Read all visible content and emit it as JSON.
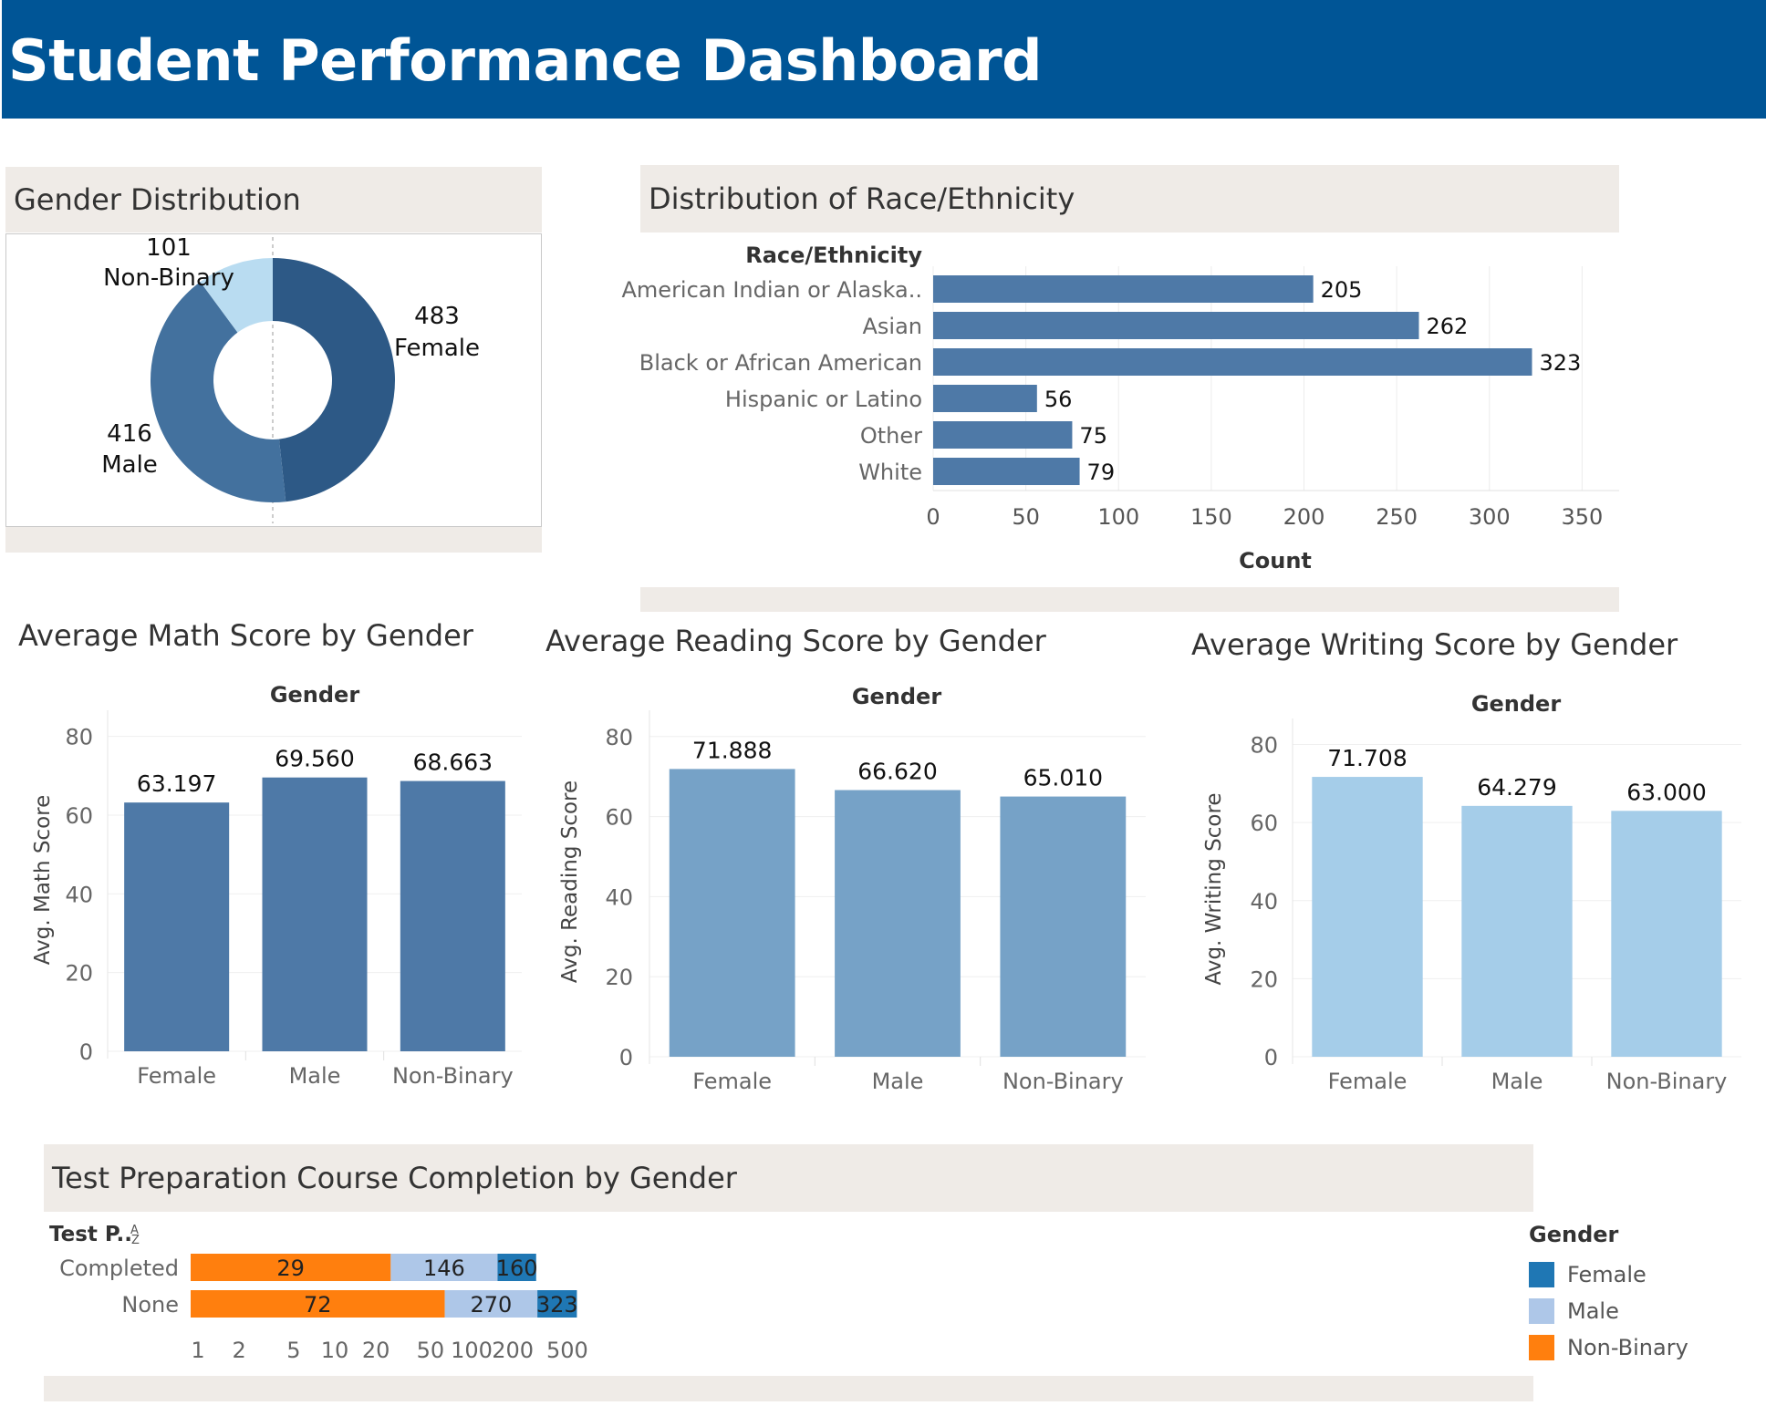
{
  "header": {
    "title": "Student Performance Dashboard"
  },
  "colors": {
    "header_bg": "#005596",
    "panel_bg": "#efebe7",
    "female_dark": "#2d5986",
    "male_mid": "#43719e",
    "nonbinary_light": "#b9dcf1",
    "race_bar": "#4e79a7",
    "math_bar": "#4e79a7",
    "reading_bar": "#76a2c7",
    "writing_bar": "#a5cde9",
    "prep_female": "#1f77b4",
    "prep_male": "#aec7e8",
    "prep_nonbinary": "#ff7f0e"
  },
  "gender_distribution": {
    "title": "Gender Distribution",
    "chart_data": {
      "type": "pie",
      "slices": [
        {
          "name": "Female",
          "value": 483,
          "value_label": "483",
          "color": "#2d5986"
        },
        {
          "name": "Male",
          "value": 416,
          "value_label": "416",
          "color": "#43719e"
        },
        {
          "name": "Non-Binary",
          "value": 101,
          "value_label": "101",
          "color": "#b9dcf1"
        }
      ]
    }
  },
  "race": {
    "title": "Distribution of Race/Ethnicity",
    "chart_data": {
      "type": "bar",
      "orientation": "horizontal",
      "row_header": "Race/Ethnicity",
      "categories": [
        "American Indian or Alaska..",
        "Asian",
        "Black or African American",
        "Hispanic or Latino",
        "Other",
        "White"
      ],
      "values": [
        205,
        262,
        323,
        56,
        75,
        79
      ],
      "xlabel": "Count",
      "xlim": [
        0,
        370
      ],
      "xticks": [
        0,
        50,
        100,
        150,
        200,
        250,
        300,
        350
      ],
      "grid": true
    }
  },
  "math": {
    "title": "Average Math Score by Gender",
    "chart_data": {
      "type": "bar",
      "header": "Gender",
      "categories": [
        "Female",
        "Male",
        "Non-Binary"
      ],
      "values": [
        63.197,
        69.56,
        68.663
      ],
      "value_labels": [
        "63.197",
        "69.560",
        "68.663"
      ],
      "ylabel": "Avg. Math Score",
      "ylim": [
        0,
        82
      ],
      "yticks": [
        0,
        20,
        40,
        60,
        80
      ]
    }
  },
  "reading": {
    "title": "Average Reading Score by Gender",
    "chart_data": {
      "type": "bar",
      "header": "Gender",
      "categories": [
        "Female",
        "Male",
        "Non-Binary"
      ],
      "values": [
        71.888,
        66.62,
        65.01
      ],
      "value_labels": [
        "71.888",
        "66.620",
        "65.010"
      ],
      "ylabel": "Avg. Reading Score",
      "ylim": [
        0,
        82
      ],
      "yticks": [
        0,
        20,
        40,
        60,
        80
      ]
    }
  },
  "writing": {
    "title": "Average Writing Score by Gender",
    "chart_data": {
      "type": "bar",
      "header": "Gender",
      "categories": [
        "Female",
        "Male",
        "Non-Binary"
      ],
      "values": [
        71.708,
        64.279,
        63.0
      ],
      "value_labels": [
        "71.708",
        "64.279",
        "63.000"
      ],
      "ylabel": "Avg. Writing Score",
      "ylim": [
        0,
        82
      ],
      "yticks": [
        0,
        20,
        40,
        60,
        80
      ]
    }
  },
  "prep": {
    "title": "Test Preparation Course Completion by Gender",
    "row_header": "Test P..",
    "sort_icon": "sort-alpha-icon",
    "legend_title": "Gender",
    "chart_data": {
      "type": "bar",
      "orientation": "horizontal",
      "stacked": true,
      "x_scale": "log",
      "categories": [
        "Completed",
        "None"
      ],
      "series": [
        {
          "name": "Non-Binary",
          "values": [
            29,
            72
          ],
          "color": "#ff7f0e"
        },
        {
          "name": "Male",
          "values": [
            146,
            270
          ],
          "color": "#aec7e8"
        },
        {
          "name": "Female",
          "values": [
            160,
            323
          ],
          "color": "#1f77b4"
        }
      ],
      "xticks": [
        1,
        2,
        5,
        10,
        20,
        50,
        100,
        200,
        500
      ]
    },
    "legend": [
      {
        "label": "Female",
        "color": "#1f77b4"
      },
      {
        "label": "Male",
        "color": "#aec7e8"
      },
      {
        "label": "Non-Binary",
        "color": "#ff7f0e"
      }
    ]
  }
}
